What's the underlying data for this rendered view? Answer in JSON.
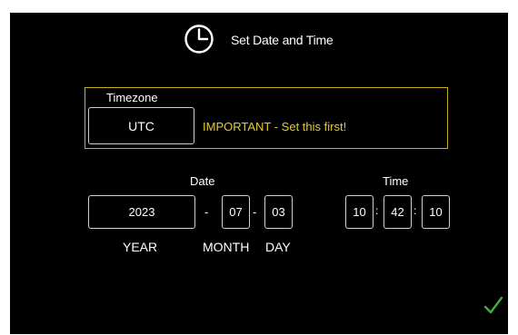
{
  "header": {
    "title": "Set Date and Time",
    "icon": "clock-icon"
  },
  "timezone": {
    "label": "Timezone",
    "value": "UTC",
    "warning": "IMPORTANT - Set this first!"
  },
  "date": {
    "label": "Date",
    "year": "2023",
    "month": "07",
    "day": "03",
    "separator": "-",
    "year_label": "YEAR",
    "month_label": "MONTH",
    "day_label": "DAY"
  },
  "time": {
    "label": "Time",
    "hour": "10",
    "minute": "42",
    "second": "10",
    "separator": ":"
  },
  "confirm": {
    "icon": "check-icon"
  },
  "colors": {
    "background": "#000000",
    "accent": "#e8cb2a",
    "box_border": "#c9b21b",
    "confirm": "#3fae3f"
  }
}
